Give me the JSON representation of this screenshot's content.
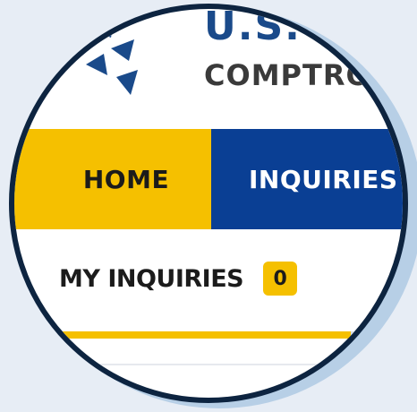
{
  "header": {
    "org_name_top": "U.S.",
    "org_name_sub": "COMPTRO"
  },
  "nav": {
    "items": [
      {
        "label": "HOME",
        "active": true
      },
      {
        "label": "INQUIRIES",
        "active": false
      }
    ]
  },
  "content": {
    "tab_label": "MY INQUIRIES",
    "tab_count": "0"
  },
  "colors": {
    "brand_blue": "#0a3f94",
    "accent_yellow": "#f5c000",
    "ring_navy": "#0d2440"
  },
  "icons": {
    "logo": "comptroller-logo-icon"
  }
}
